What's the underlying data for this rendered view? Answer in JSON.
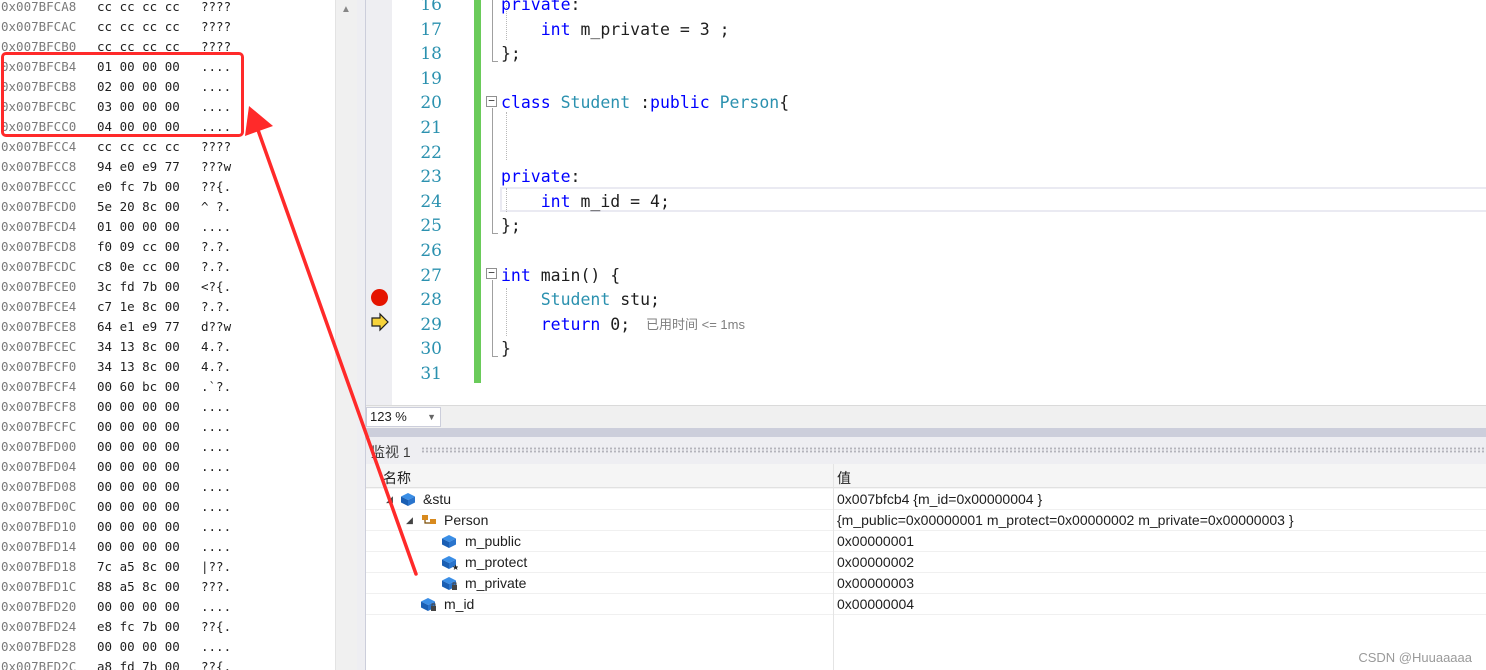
{
  "memory": {
    "rows": [
      {
        "addr": "0x007BFCA8",
        "bytes": "cc cc cc cc",
        "ascii": "????"
      },
      {
        "addr": "0x007BFCAC",
        "bytes": "cc cc cc cc",
        "ascii": "????"
      },
      {
        "addr": "0x007BFCB0",
        "bytes": "cc cc cc cc",
        "ascii": "????"
      },
      {
        "addr": "0x007BFCB4",
        "bytes": "01 00 00 00",
        "ascii": "...."
      },
      {
        "addr": "0x007BFCB8",
        "bytes": "02 00 00 00",
        "ascii": "...."
      },
      {
        "addr": "0x007BFCBC",
        "bytes": "03 00 00 00",
        "ascii": "...."
      },
      {
        "addr": "0x007BFCC0",
        "bytes": "04 00 00 00",
        "ascii": "...."
      },
      {
        "addr": "0x007BFCC4",
        "bytes": "cc cc cc cc",
        "ascii": "????"
      },
      {
        "addr": "0x007BFCC8",
        "bytes": "94 e0 e9 77",
        "ascii": "???w"
      },
      {
        "addr": "0x007BFCCC",
        "bytes": "e0 fc 7b 00",
        "ascii": "??{."
      },
      {
        "addr": "0x007BFCD0",
        "bytes": "5e 20 8c 00",
        "ascii": "^ ?."
      },
      {
        "addr": "0x007BFCD4",
        "bytes": "01 00 00 00",
        "ascii": "...."
      },
      {
        "addr": "0x007BFCD8",
        "bytes": "f0 09 cc 00",
        "ascii": "?.?."
      },
      {
        "addr": "0x007BFCDC",
        "bytes": "c8 0e cc 00",
        "ascii": "?.?."
      },
      {
        "addr": "0x007BFCE0",
        "bytes": "3c fd 7b 00",
        "ascii": "<?{."
      },
      {
        "addr": "0x007BFCE4",
        "bytes": "c7 1e 8c 00",
        "ascii": "?.?."
      },
      {
        "addr": "0x007BFCE8",
        "bytes": "64 e1 e9 77",
        "ascii": "d??w"
      },
      {
        "addr": "0x007BFCEC",
        "bytes": "34 13 8c 00",
        "ascii": "4.?."
      },
      {
        "addr": "0x007BFCF0",
        "bytes": "34 13 8c 00",
        "ascii": "4.?."
      },
      {
        "addr": "0x007BFCF4",
        "bytes": "00 60 bc 00",
        "ascii": ".`?."
      },
      {
        "addr": "0x007BFCF8",
        "bytes": "00 00 00 00",
        "ascii": "...."
      },
      {
        "addr": "0x007BFCFC",
        "bytes": "00 00 00 00",
        "ascii": "...."
      },
      {
        "addr": "0x007BFD00",
        "bytes": "00 00 00 00",
        "ascii": "...."
      },
      {
        "addr": "0x007BFD04",
        "bytes": "00 00 00 00",
        "ascii": "...."
      },
      {
        "addr": "0x007BFD08",
        "bytes": "00 00 00 00",
        "ascii": "...."
      },
      {
        "addr": "0x007BFD0C",
        "bytes": "00 00 00 00",
        "ascii": "...."
      },
      {
        "addr": "0x007BFD10",
        "bytes": "00 00 00 00",
        "ascii": "...."
      },
      {
        "addr": "0x007BFD14",
        "bytes": "00 00 00 00",
        "ascii": "...."
      },
      {
        "addr": "0x007BFD18",
        "bytes": "7c a5 8c 00",
        "ascii": "|??."
      },
      {
        "addr": "0x007BFD1C",
        "bytes": "88 a5 8c 00",
        "ascii": "???."
      },
      {
        "addr": "0x007BFD20",
        "bytes": "00 00 00 00",
        "ascii": "...."
      },
      {
        "addr": "0x007BFD24",
        "bytes": "e8 fc 7b 00",
        "ascii": "??{."
      },
      {
        "addr": "0x007BFD28",
        "bytes": "00 00 00 00",
        "ascii": "...."
      },
      {
        "addr": "0x007BFD2C",
        "bytes": "a8 fd 7b 00",
        "ascii": "??{."
      }
    ]
  },
  "editor": {
    "lines": [
      {
        "no": "16",
        "parts": [
          {
            "t": "private",
            "c": "kw"
          },
          {
            "t": ":",
            "c": ""
          }
        ]
      },
      {
        "no": "17",
        "parts": [
          {
            "t": "    ",
            "c": ""
          },
          {
            "t": "int",
            "c": "kw"
          },
          {
            "t": " m_private = 3 ;",
            "c": ""
          }
        ]
      },
      {
        "no": "18",
        "parts": [
          {
            "t": "};",
            "c": ""
          }
        ]
      },
      {
        "no": "19",
        "parts": []
      },
      {
        "no": "20",
        "parts": [
          {
            "t": "class",
            "c": "kw"
          },
          {
            "t": " ",
            "c": ""
          },
          {
            "t": "Student",
            "c": "ty"
          },
          {
            "t": " :",
            "c": ""
          },
          {
            "t": "public",
            "c": "kw"
          },
          {
            "t": " ",
            "c": ""
          },
          {
            "t": "Person",
            "c": "ty"
          },
          {
            "t": "{",
            "c": ""
          }
        ]
      },
      {
        "no": "21",
        "parts": []
      },
      {
        "no": "22",
        "parts": []
      },
      {
        "no": "23",
        "parts": [
          {
            "t": "private",
            "c": "kw"
          },
          {
            "t": ":",
            "c": ""
          }
        ]
      },
      {
        "no": "24",
        "parts": [
          {
            "t": "    ",
            "c": ""
          },
          {
            "t": "int",
            "c": "kw"
          },
          {
            "t": " m_id = 4;",
            "c": ""
          }
        ]
      },
      {
        "no": "25",
        "parts": [
          {
            "t": "};",
            "c": ""
          }
        ]
      },
      {
        "no": "26",
        "parts": []
      },
      {
        "no": "27",
        "parts": [
          {
            "t": "int",
            "c": "kw"
          },
          {
            "t": " main() {",
            "c": ""
          }
        ]
      },
      {
        "no": "28",
        "parts": [
          {
            "t": "    ",
            "c": ""
          },
          {
            "t": "Student",
            "c": "ty"
          },
          {
            "t": " stu;",
            "c": ""
          }
        ]
      },
      {
        "no": "29",
        "parts": [
          {
            "t": "    ",
            "c": ""
          },
          {
            "t": "return",
            "c": "kw"
          },
          {
            "t": " 0;",
            "c": ""
          }
        ],
        "perf": "已用时间 <= 1ms"
      },
      {
        "no": "30",
        "parts": [
          {
            "t": "}",
            "c": ""
          }
        ]
      },
      {
        "no": "31",
        "parts": []
      }
    ]
  },
  "zoom": {
    "value": "123 %"
  },
  "watch": {
    "title": "监视 1",
    "columns": {
      "name": "名称",
      "value": "值"
    },
    "rows": [
      {
        "name": "&stu",
        "value": "0x007bfcb4 {m_id=0x00000004 }",
        "expander": "◢",
        "icon": "object-icon"
      },
      {
        "name": "Person",
        "value": "{m_public=0x00000001 m_protect=0x00000002 m_private=0x00000003 }",
        "expander": "◢",
        "icon": "base-class-icon"
      },
      {
        "name": "m_public",
        "value": "0x00000001",
        "expander": "",
        "icon": "public-field-icon"
      },
      {
        "name": "m_protect",
        "value": "0x00000002",
        "expander": "",
        "icon": "protected-field-icon"
      },
      {
        "name": "m_private",
        "value": "0x00000003",
        "expander": "",
        "icon": "private-field-icon"
      },
      {
        "name": "m_id",
        "value": "0x00000004",
        "expander": "",
        "icon": "private-field-icon"
      }
    ]
  },
  "watermark": "CSDN @Huuaaaaa",
  "colors": {
    "keyword": "#0000ff",
    "type": "#2b91af",
    "line_number": "#2b91af",
    "breakpoint": "#e51400",
    "annotation": "#ff2a2a",
    "change_bar": "#6acb5a"
  }
}
